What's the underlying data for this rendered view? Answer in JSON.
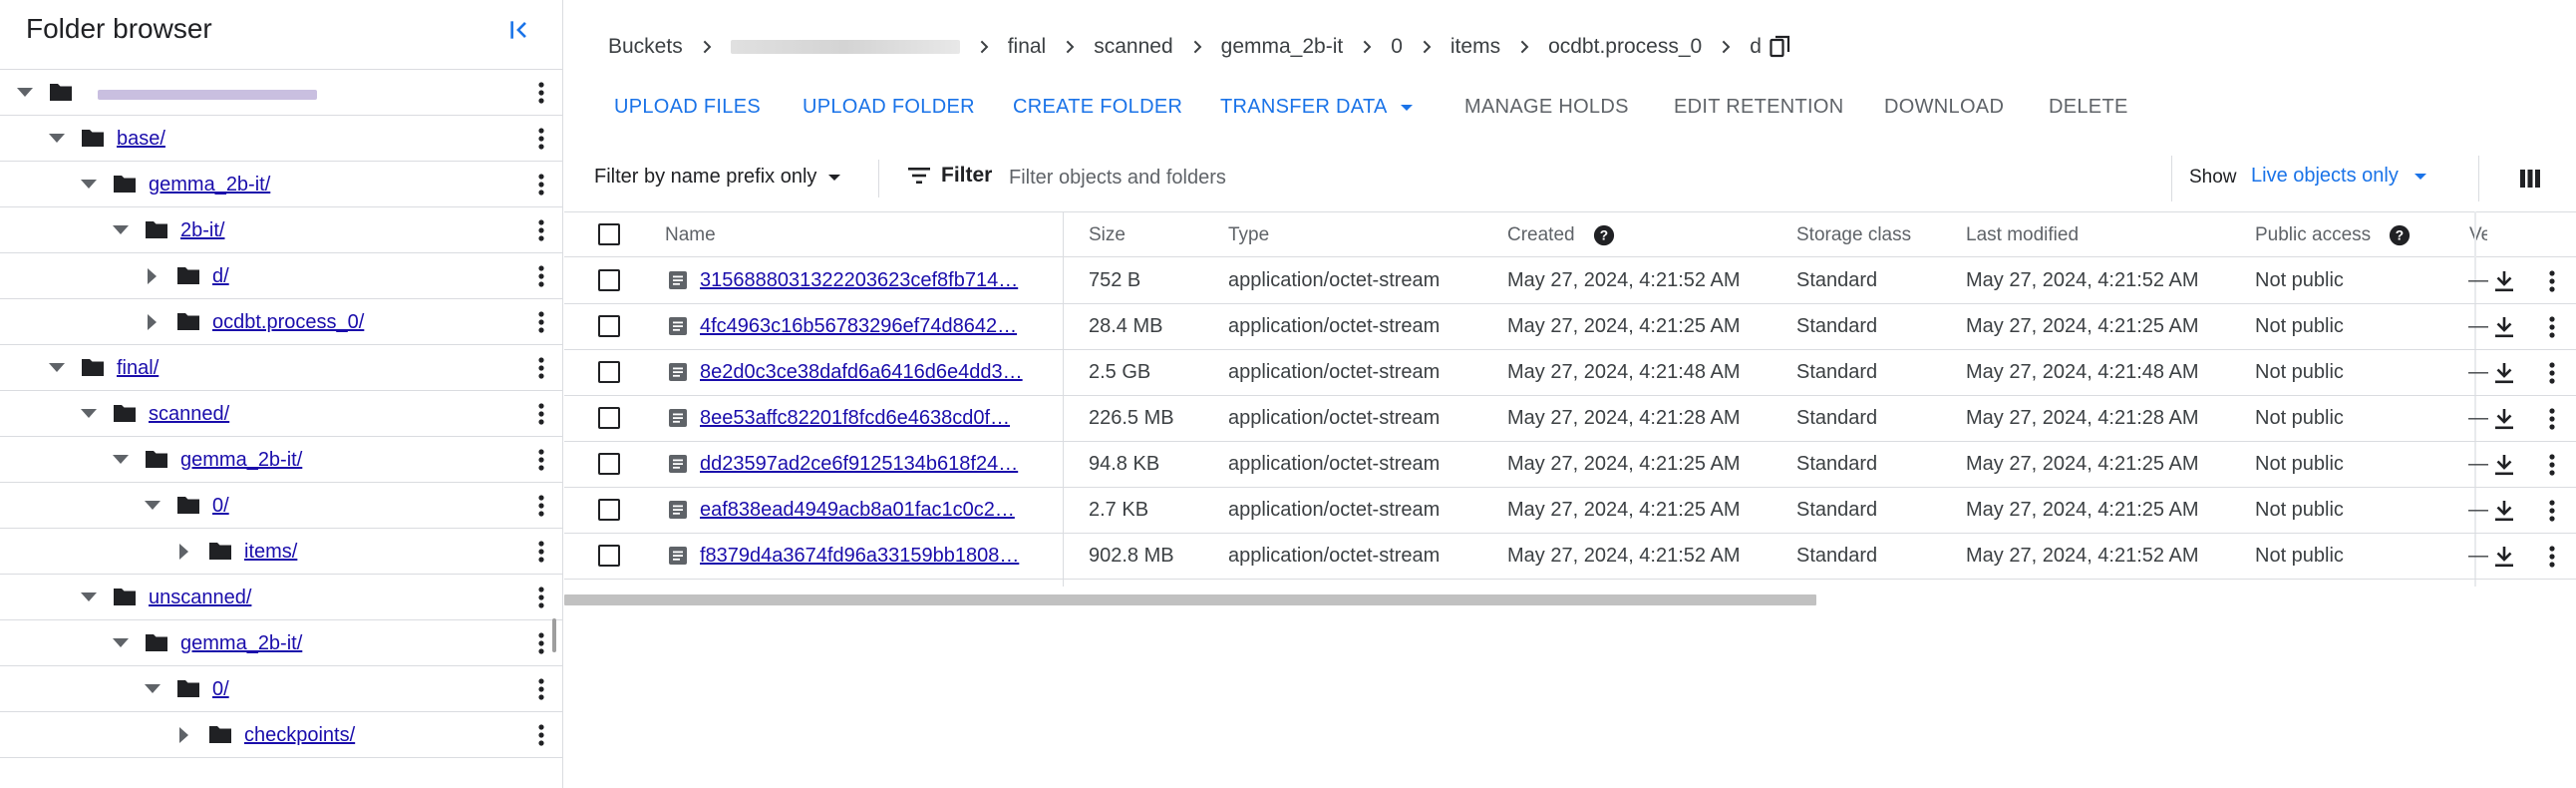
{
  "sidebar": {
    "title": "Folder browser",
    "tree": [
      {
        "label": "",
        "depth": 0,
        "expanded": true,
        "redacted": true
      },
      {
        "label": "base/",
        "depth": 1,
        "expanded": true
      },
      {
        "label": "gemma_2b-it/",
        "depth": 2,
        "expanded": true
      },
      {
        "label": "2b-it/",
        "depth": 3,
        "expanded": true
      },
      {
        "label": "d/",
        "depth": 4,
        "expanded": false
      },
      {
        "label": "ocdbt.process_0/",
        "depth": 4,
        "expanded": false
      },
      {
        "label": "final/",
        "depth": 1,
        "expanded": true
      },
      {
        "label": "scanned/",
        "depth": 2,
        "expanded": true
      },
      {
        "label": "gemma_2b-it/",
        "depth": 3,
        "expanded": true
      },
      {
        "label": "0/",
        "depth": 4,
        "expanded": true
      },
      {
        "label": "items/",
        "depth": 5,
        "expanded": false
      },
      {
        "label": "unscanned/",
        "depth": 2,
        "expanded": true
      },
      {
        "label": "gemma_2b-it/",
        "depth": 3,
        "expanded": true
      },
      {
        "label": "0/",
        "depth": 4,
        "expanded": true
      },
      {
        "label": "checkpoints/",
        "depth": 5,
        "expanded": false
      }
    ]
  },
  "breadcrumb": {
    "items": [
      "Buckets",
      "",
      "final",
      "scanned",
      "gemma_2b-it",
      "0",
      "items",
      "ocdbt.process_0",
      "d"
    ]
  },
  "actions": {
    "upload_files": "UPLOAD FILES",
    "upload_folder": "UPLOAD FOLDER",
    "create_folder": "CREATE FOLDER",
    "transfer_data": "TRANSFER DATA",
    "manage_holds": "MANAGE HOLDS",
    "edit_retention": "EDIT RETENTION",
    "download": "DOWNLOAD",
    "delete": "DELETE"
  },
  "filterbar": {
    "prefix_mode": "Filter by name prefix only",
    "filter_label": "Filter",
    "filter_placeholder": "Filter objects and folders",
    "show_label": "Show",
    "show_value": "Live objects only"
  },
  "table": {
    "columns": {
      "name": "Name",
      "size": "Size",
      "type": "Type",
      "created": "Created",
      "storage_class": "Storage class",
      "last_modified": "Last modified",
      "public_access": "Public access",
      "version": "Ve"
    },
    "rows": [
      {
        "name": "3156888031322203623cef8fb714…",
        "size": "752 B",
        "type": "application/octet-stream",
        "created": "May 27, 2024, 4:21:52 AM",
        "storage_class": "Standard",
        "last_modified": "May 27, 2024, 4:21:52 AM",
        "public_access": "Not public",
        "version": "—"
      },
      {
        "name": "4fc4963c16b56783296ef74d8642…",
        "size": "28.4 MB",
        "type": "application/octet-stream",
        "created": "May 27, 2024, 4:21:25 AM",
        "storage_class": "Standard",
        "last_modified": "May 27, 2024, 4:21:25 AM",
        "public_access": "Not public",
        "version": "—"
      },
      {
        "name": "8e2d0c3ce38dafd6a6416d6e4dd3…",
        "size": "2.5 GB",
        "type": "application/octet-stream",
        "created": "May 27, 2024, 4:21:48 AM",
        "storage_class": "Standard",
        "last_modified": "May 27, 2024, 4:21:48 AM",
        "public_access": "Not public",
        "version": "—"
      },
      {
        "name": "8ee53affc82201f8fcd6e4638cd0f…",
        "size": "226.5 MB",
        "type": "application/octet-stream",
        "created": "May 27, 2024, 4:21:28 AM",
        "storage_class": "Standard",
        "last_modified": "May 27, 2024, 4:21:28 AM",
        "public_access": "Not public",
        "version": "—"
      },
      {
        "name": "dd23597ad2ce6f9125134b618f24…",
        "size": "94.8 KB",
        "type": "application/octet-stream",
        "created": "May 27, 2024, 4:21:25 AM",
        "storage_class": "Standard",
        "last_modified": "May 27, 2024, 4:21:25 AM",
        "public_access": "Not public",
        "version": "—"
      },
      {
        "name": "eaf838ead4949acb8a01fac1c0c2…",
        "size": "2.7 KB",
        "type": "application/octet-stream",
        "created": "May 27, 2024, 4:21:25 AM",
        "storage_class": "Standard",
        "last_modified": "May 27, 2024, 4:21:25 AM",
        "public_access": "Not public",
        "version": "—"
      },
      {
        "name": "f8379d4a3674fd96a33159bb1808…",
        "size": "902.8 MB",
        "type": "application/octet-stream",
        "created": "May 27, 2024, 4:21:52 AM",
        "storage_class": "Standard",
        "last_modified": "May 27, 2024, 4:21:52 AM",
        "public_access": "Not public",
        "version": "—"
      }
    ]
  },
  "colors": {
    "accent": "#1a73e8",
    "link": "#1a0dab",
    "muted": "#5f6368",
    "divider": "#dadce0"
  }
}
